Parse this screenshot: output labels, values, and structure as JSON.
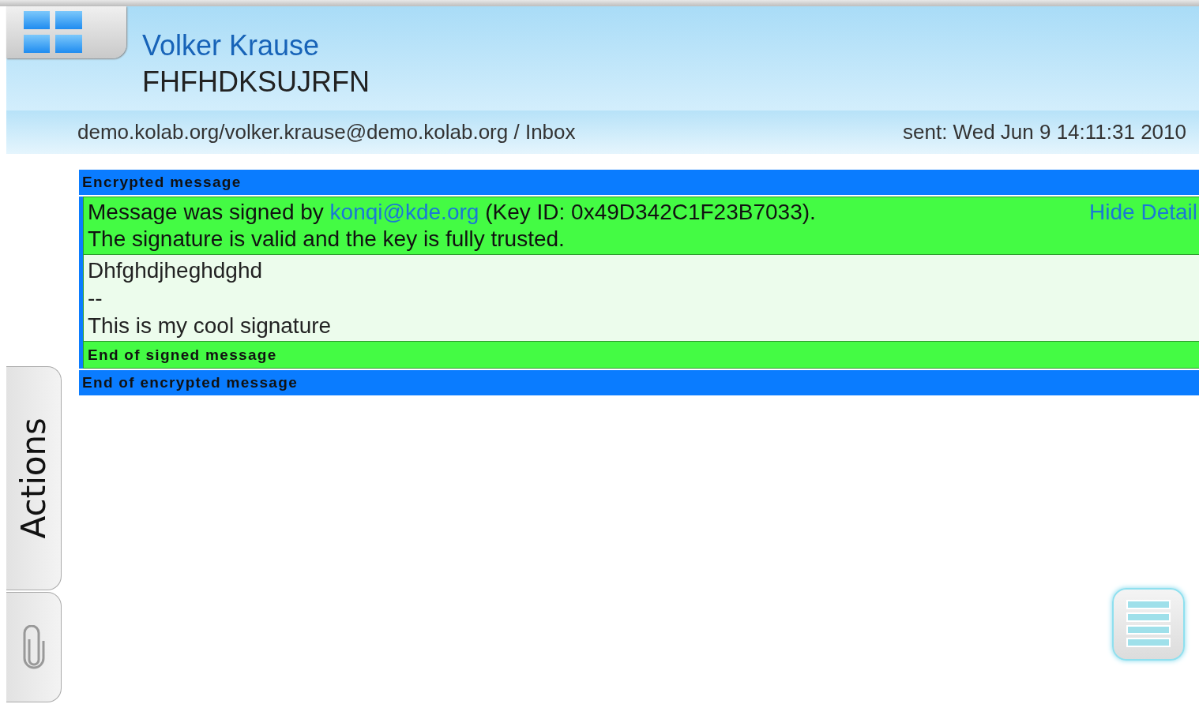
{
  "header": {
    "sender": "Volker Krause",
    "subject": "FHFHDKSUJRFN",
    "folder": "demo.kolab.org/volker.krause@demo.kolab.org / Inbox",
    "sent": "sent: Wed Jun 9 14:11:31 2010"
  },
  "message": {
    "encrypted_header": "Encrypted message",
    "signature_status": {
      "text_before": "Message was signed by ",
      "signer": "konqi@kde.org",
      "text_after": " (Key ID: 0x49D342C1F23B7033).",
      "validity": "The signature is valid and the key is fully trusted.",
      "details_link": "Hide Detail"
    },
    "body": [
      "Dhfghdjheghdghd",
      "--",
      "This is my cool signature"
    ],
    "signed_footer": "End of signed message",
    "encrypted_footer": "End of encrypted message"
  },
  "side_tabs": [
    {
      "kind": "text",
      "label": "Actions"
    },
    {
      "kind": "attachment"
    }
  ]
}
